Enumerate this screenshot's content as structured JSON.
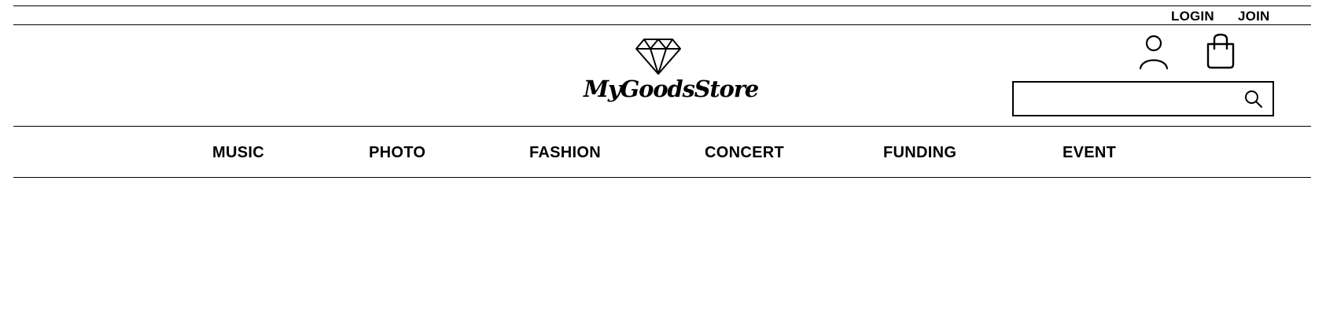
{
  "utility_nav": {
    "login_label": "LOGIN",
    "join_label": "JOIN"
  },
  "header": {
    "logo_text": "MyGoodsStore",
    "logo_icon": "diamond-icon",
    "account_icon": "user-icon",
    "cart_icon": "shopping-bag-icon",
    "search": {
      "value": "",
      "placeholder": "",
      "icon": "search-icon"
    }
  },
  "main_nav": {
    "items": [
      {
        "label": "MUSIC"
      },
      {
        "label": "PHOTO"
      },
      {
        "label": "FASHION"
      },
      {
        "label": "CONCERT"
      },
      {
        "label": "FUNDING"
      },
      {
        "label": "EVENT"
      }
    ]
  },
  "colors": {
    "text": "#000000",
    "background": "#ffffff",
    "lines": "#000000"
  }
}
